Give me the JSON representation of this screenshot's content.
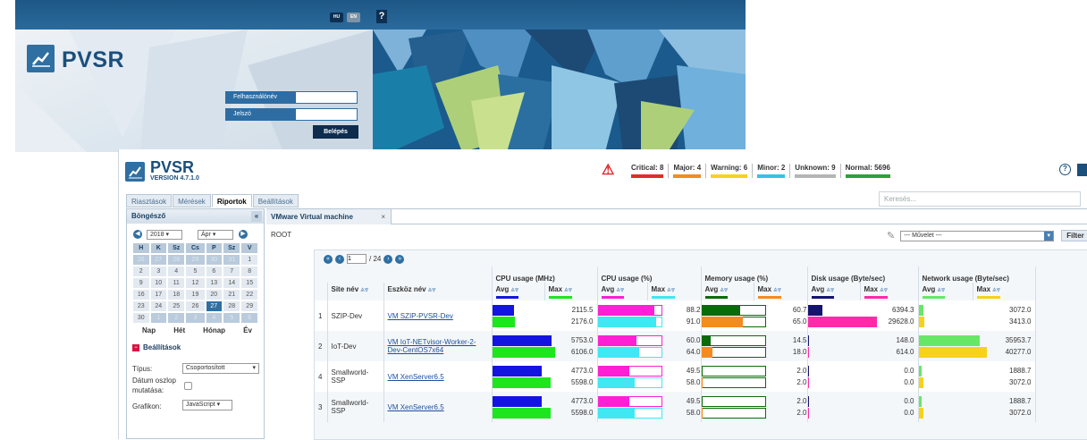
{
  "login": {
    "lang_hu": "HU",
    "lang_en": "EN",
    "help": "?",
    "logo": "PVSR",
    "username_label": "Felhasználónév",
    "password_label": "Jelszó",
    "login_button": "Belépés"
  },
  "header": {
    "logo": "PVSR",
    "version": "VERSION 4.7.1.0",
    "alerts": [
      {
        "label": "Critical: 8",
        "color": "#e32b2b"
      },
      {
        "label": "Major: 4",
        "color": "#f58a1f"
      },
      {
        "label": "Warning: 6",
        "color": "#f7d21a"
      },
      {
        "label": "Minor: 2",
        "color": "#32c3e8"
      },
      {
        "label": "Unknown: 9",
        "color": "#b5b5b5"
      },
      {
        "label": "Normal: 5696",
        "color": "#27a33a"
      }
    ],
    "search_placeholder": "Keresés..."
  },
  "tabs": [
    "Riasztások",
    "Mérések",
    "Riportok",
    "Beállítások"
  ],
  "sidebar": {
    "title": "Böngésző",
    "collapse": "«",
    "year": "2018",
    "month": "Ápr",
    "weekdays": [
      "H",
      "K",
      "Sz",
      "Cs",
      "P",
      "Sz",
      "V"
    ],
    "weeks": [
      [
        "26",
        "27",
        "28",
        "29",
        "30",
        "31",
        "1"
      ],
      [
        "2",
        "3",
        "4",
        "5",
        "6",
        "7",
        "8"
      ],
      [
        "9",
        "10",
        "11",
        "12",
        "13",
        "14",
        "15"
      ],
      [
        "16",
        "17",
        "18",
        "19",
        "20",
        "21",
        "22"
      ],
      [
        "23",
        "24",
        "25",
        "26",
        "27",
        "28",
        "29"
      ],
      [
        "30",
        "1",
        "2",
        "3",
        "4",
        "5",
        "6"
      ]
    ],
    "periods": [
      "Nap",
      "Hét",
      "Hónap",
      "Év"
    ],
    "settings_title": "Beállítások",
    "type_label": "Típus:",
    "type_value": "Csoportosított",
    "date_col_label_1": "Dátum oszlop",
    "date_col_label_2": "mutatása:",
    "chart_label": "Grafikon:",
    "chart_value": "JavaScript"
  },
  "main": {
    "tab_title": "VMware Virtual machine",
    "tab_close": "×",
    "root": "ROOT",
    "action_placeholder": "--- Művelet ---",
    "filter": "Filter",
    "page_current": "1",
    "page_total": "/ 24",
    "group_headers": [
      "CPU usage (MHz)",
      "CPU usage (%)",
      "Memory usage (%)",
      "Disk usage (Byte/sec)",
      "Network usage (Byte/sec)"
    ],
    "col_site": "Site név",
    "col_device": "Eszköz név",
    "avg": "Avg",
    "max": "Max",
    "rows": [
      {
        "num": "1",
        "site": "SZIP-Dev",
        "device": "VM SZIP-PVSR-Dev",
        "cpu_mhz": [
          "2115.5",
          "2176.0"
        ],
        "cpu_pct": [
          "88.2",
          "91.0"
        ],
        "mem": [
          "60.7",
          "65.0"
        ],
        "disk": [
          "6394.3",
          "29628.0"
        ],
        "net": [
          "3072.0",
          "3413.0"
        ]
      },
      {
        "num": "2",
        "site": "IoT-Dev",
        "device": "VM IoT-NETvisor-Worker-2-Dev-CentOS7x64",
        "cpu_mhz": [
          "5753.0",
          "6106.0"
        ],
        "cpu_pct": [
          "60.0",
          "64.0"
        ],
        "mem": [
          "14.5",
          "18.0"
        ],
        "disk": [
          "148.0",
          "614.0"
        ],
        "net": [
          "35953.7",
          "40277.0"
        ]
      },
      {
        "num": "4",
        "site": "Smallworld-SSP",
        "device": "VM XenServer6.5",
        "cpu_mhz": [
          "4773.0",
          "5598.0"
        ],
        "cpu_pct": [
          "49.5",
          "58.0"
        ],
        "mem": [
          "2.0",
          "2.0"
        ],
        "disk": [
          "0.0",
          "0.0"
        ],
        "net": [
          "1888.7",
          "3072.0"
        ]
      },
      {
        "num": "3",
        "site": "Smallworld-SSP",
        "device": "VM XenServer6.5",
        "cpu_mhz": [
          "4773.0",
          "5598.0"
        ],
        "cpu_pct": [
          "49.5",
          "58.0"
        ],
        "mem": [
          "2.0",
          "2.0"
        ],
        "disk": [
          "0.0",
          "0.0"
        ],
        "net": [
          "1888.7",
          "3072.0"
        ]
      }
    ]
  },
  "colors": {
    "cpu_avg": "#1414e0",
    "cpu_max": "#1ee61e",
    "pct_avg": "#ff1fd4",
    "pct_max": "#3fe8f2",
    "mem_avg": "#0a6b0a",
    "mem_max": "#f58a1f",
    "disk_avg": "#141470",
    "disk_max": "#ff2aa8",
    "net_avg": "#66e866",
    "net_max": "#f7d21a"
  }
}
